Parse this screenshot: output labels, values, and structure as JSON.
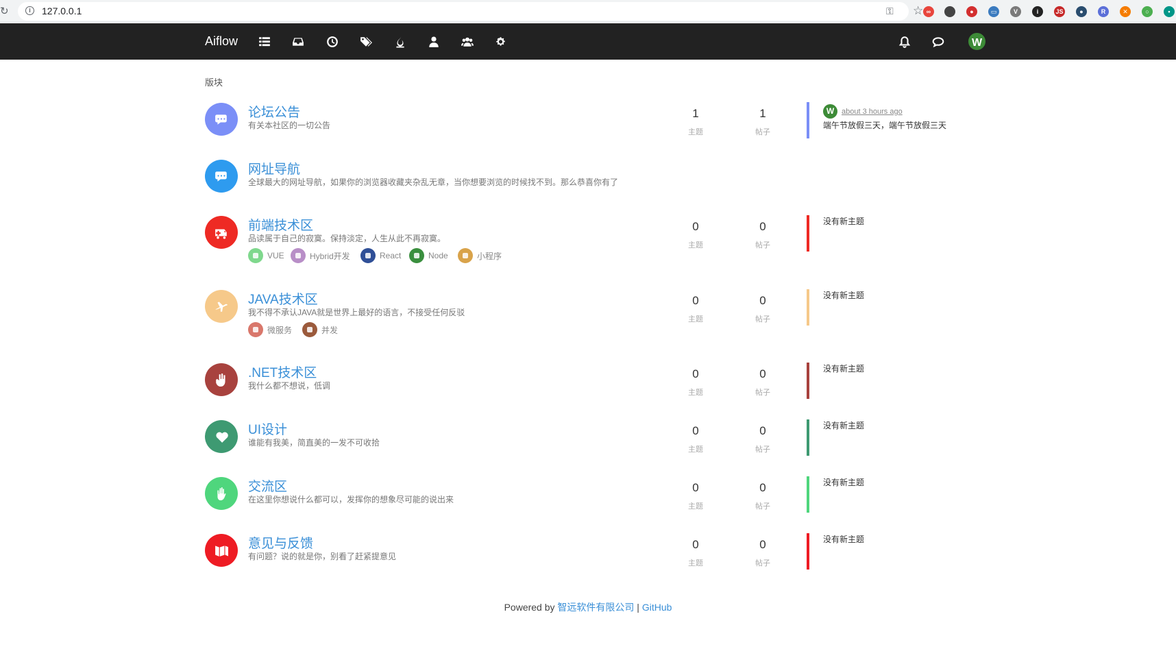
{
  "browser": {
    "url": "127.0.0.1",
    "extensions": [
      {
        "name": "ext-infinity-icon",
        "color": "#e8453c",
        "glyph": "∞"
      },
      {
        "name": "ext-code-icon",
        "color": "#444444",
        "glyph": "</>"
      },
      {
        "name": "ext-shield-icon",
        "color": "#d32f2f",
        "glyph": "●"
      },
      {
        "name": "ext-screen-icon",
        "color": "#3b7bbf",
        "glyph": "▭"
      },
      {
        "name": "ext-vue-icon",
        "color": "#7a7a7a",
        "glyph": "V"
      },
      {
        "name": "ext-info-icon",
        "color": "#222222",
        "glyph": "i"
      },
      {
        "name": "ext-js-icon",
        "color": "#c62828",
        "glyph": "JS"
      },
      {
        "name": "ext-globe-icon",
        "color": "#2a4d6e",
        "glyph": "●"
      },
      {
        "name": "ext-r-icon",
        "color": "#5b6fd8",
        "glyph": "R"
      },
      {
        "name": "ext-x-icon",
        "color": "#f57c00",
        "glyph": "✕"
      },
      {
        "name": "ext-chrome-icon",
        "color": "#4caf50",
        "glyph": "○"
      },
      {
        "name": "ext-dot-icon",
        "color": "#009688",
        "glyph": "•"
      }
    ]
  },
  "navbar": {
    "brand": "Aiflow",
    "avatar_letter": "W"
  },
  "section_title": "版块",
  "stat_labels": {
    "topics": "主题",
    "posts": "帖子"
  },
  "no_new_topic": "没有新主题",
  "latest_post": {
    "avatar_letter": "W",
    "time": "about 3 hours ago",
    "topic": "端午节放假三天，端午节放假三天"
  },
  "categories": [
    {
      "title": "论坛公告",
      "desc": "有关本社区的一切公告",
      "topics": "1",
      "posts": "1",
      "color": "#7b8ff7",
      "icon": "comments-icon"
    },
    {
      "title": "网址导航",
      "desc": "全球最大的网址导航，如果你的浏览器收藏夹杂乱无章，当你想要浏览的时候找不到。那么恭喜你有了",
      "color": "#2e9bef",
      "icon": "comments-icon"
    },
    {
      "title": "前端技术区",
      "desc": "品读属于自己的寂寞。保持淡定，人生从此不再寂寞。",
      "topics": "0",
      "posts": "0",
      "color": "#ee2a24",
      "icon": "ambulance-icon",
      "tags": [
        {
          "label": "VUE",
          "color": "#7fd88d"
        },
        {
          "label": "Hybrid开发",
          "color": "#b88ec7"
        },
        {
          "label": "React",
          "color": "#2f4f97"
        },
        {
          "label": "Node",
          "color": "#3a8f3e"
        },
        {
          "label": "小程序",
          "color": "#d9a34a"
        }
      ]
    },
    {
      "title": "JAVA技术区",
      "desc": "我不得不承认JAVA就是世界上最好的语言，不接受任何反驳",
      "topics": "0",
      "posts": "0",
      "color": "#f6c98a",
      "icon": "plane-icon",
      "tags": [
        {
          "label": "微服务",
          "color": "#d9776b"
        },
        {
          "label": "并发",
          "color": "#9b5a3c"
        }
      ]
    },
    {
      "title": ".NET技术区",
      "desc": "我什么都不想说，低调",
      "topics": "0",
      "posts": "0",
      "color": "#a8423e",
      "icon": "hand-icon"
    },
    {
      "title": "UI设计",
      "desc": "谁能有我美，简直美的一发不可收拾",
      "topics": "0",
      "posts": "0",
      "color": "#3e9a72",
      "icon": "heart-icon"
    },
    {
      "title": "交流区",
      "desc": "在这里你想说什么都可以，发挥你的想象尽可能的说出来",
      "topics": "0",
      "posts": "0",
      "color": "#4fd67d",
      "icon": "palm-icon"
    },
    {
      "title": "意见与反馈",
      "desc": "有问题？说的就是你，别看了赶紧提意见",
      "topics": "0",
      "posts": "0",
      "color": "#ee1c24",
      "icon": "map-icon"
    }
  ],
  "footer": {
    "prefix": "Powered by ",
    "company": "智远软件有限公司",
    "separator": " | ",
    "github": "GitHub"
  }
}
